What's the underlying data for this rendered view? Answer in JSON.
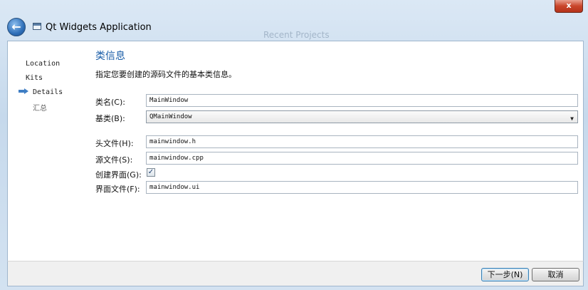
{
  "titlebar": {
    "close_label": "x",
    "back_arrow": "←",
    "app_icon": "window-icon",
    "title": "Qt Widgets Application",
    "ghost_text": "Recent Projects"
  },
  "nav": {
    "items": [
      {
        "label": "Location",
        "active": false
      },
      {
        "label": "Kits",
        "active": false
      },
      {
        "label": "Details",
        "active": true
      },
      {
        "label": "汇总",
        "active": false
      }
    ],
    "active_arrow_icon": "arrow-right-icon"
  },
  "page": {
    "heading": "类信息",
    "subtitle": "指定您要创建的源码文件的基本类信息。"
  },
  "form": {
    "class_name": {
      "label": "类名(C):",
      "value": "MainWindow"
    },
    "base_class": {
      "label": "基类(B):",
      "value": "QMainWindow",
      "caret": "▼"
    },
    "header_file": {
      "label": "头文件(H):",
      "value": "mainwindow.h"
    },
    "source_file": {
      "label": "源文件(S):",
      "value": "mainwindow.cpp"
    },
    "generate_form": {
      "label": "创建界面(G):",
      "checked": true,
      "check_glyph": "✓"
    },
    "form_file": {
      "label": "界面文件(F):",
      "value": "mainwindow.ui"
    }
  },
  "footer": {
    "next_label": "下一步(N)",
    "cancel_label": "取消"
  },
  "colors": {
    "accent": "#1b5ea8",
    "close_red": "#c9452a",
    "frame": "#c6d9ec"
  }
}
